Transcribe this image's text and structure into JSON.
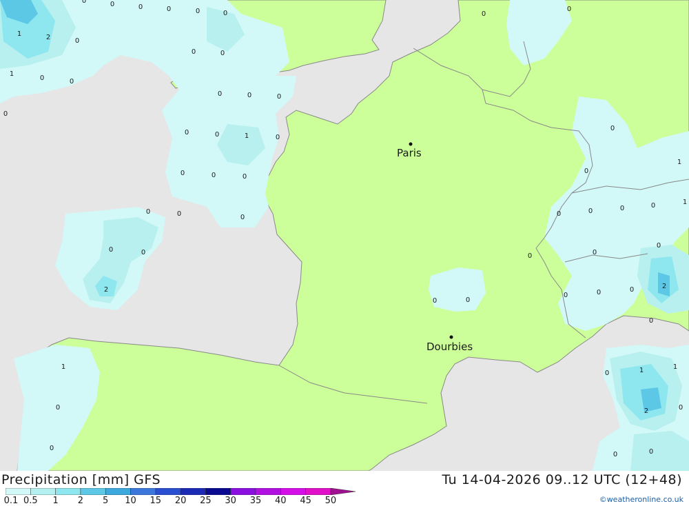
{
  "title": "Precipitation [mm] GFS",
  "timestamp": "Tu 14-04-2026 09..12 UTC (12+48)",
  "credit": "©weatheronline.co.uk",
  "colors": {
    "sea": "#e6e6e6",
    "land": "#ccff99",
    "border": "#888888",
    "precip_light": "#d2f8f8",
    "precip_05": "#b8f0f0",
    "precip_1": "#8ee6ee",
    "precip_2": "#5cc8e6"
  },
  "legend": {
    "values": [
      "0.1",
      "0.5",
      "1",
      "2",
      "5",
      "10",
      "15",
      "20",
      "25",
      "30",
      "35",
      "40",
      "45",
      "50"
    ],
    "colors": [
      "#d2f8f8",
      "#b4f0f0",
      "#8ee6ee",
      "#5cc8e6",
      "#3ca8dc",
      "#3c78dc",
      "#2a4ed0",
      "#1a2ab4",
      "#0a0a90",
      "#8a10e0",
      "#b010e0",
      "#d40ee6",
      "#e010c8",
      "#a01090"
    ]
  },
  "cities": [
    {
      "name": "Paris"
    },
    {
      "name": "Dourbies"
    }
  ],
  "labels": [
    {
      "v": "0"
    },
    {
      "v": "0"
    },
    {
      "v": "0"
    },
    {
      "v": "0"
    },
    {
      "v": "0"
    },
    {
      "v": "0"
    },
    {
      "v": "0"
    },
    {
      "v": "0"
    },
    {
      "v": "1"
    },
    {
      "v": "2"
    },
    {
      "v": "0"
    },
    {
      "v": "1"
    },
    {
      "v": "0"
    },
    {
      "v": "0"
    },
    {
      "v": "0"
    },
    {
      "v": "0"
    },
    {
      "v": "0"
    },
    {
      "v": "0"
    },
    {
      "v": "0"
    },
    {
      "v": "0"
    },
    {
      "v": "1"
    },
    {
      "v": "0"
    },
    {
      "v": "0"
    },
    {
      "v": "0"
    },
    {
      "v": "0"
    },
    {
      "v": "0"
    },
    {
      "v": "0"
    },
    {
      "v": "0"
    },
    {
      "v": "0"
    },
    {
      "v": "2"
    },
    {
      "v": "0"
    },
    {
      "v": "0"
    },
    {
      "v": "0"
    },
    {
      "v": "0"
    },
    {
      "v": "0"
    },
    {
      "v": "0"
    },
    {
      "v": "0"
    },
    {
      "v": "0"
    },
    {
      "v": "0"
    },
    {
      "v": "1"
    },
    {
      "v": "0"
    },
    {
      "v": "0"
    },
    {
      "v": "0"
    },
    {
      "v": "0"
    },
    {
      "v": "0"
    },
    {
      "v": "1"
    },
    {
      "v": "0"
    },
    {
      "v": "0"
    },
    {
      "v": "0"
    },
    {
      "v": "0"
    },
    {
      "v": "0"
    },
    {
      "v": "2"
    },
    {
      "v": "0"
    },
    {
      "v": "0"
    },
    {
      "v": "1"
    },
    {
      "v": "1"
    },
    {
      "v": "2"
    },
    {
      "v": "0"
    },
    {
      "v": "1"
    },
    {
      "v": "0"
    },
    {
      "v": "0"
    }
  ]
}
